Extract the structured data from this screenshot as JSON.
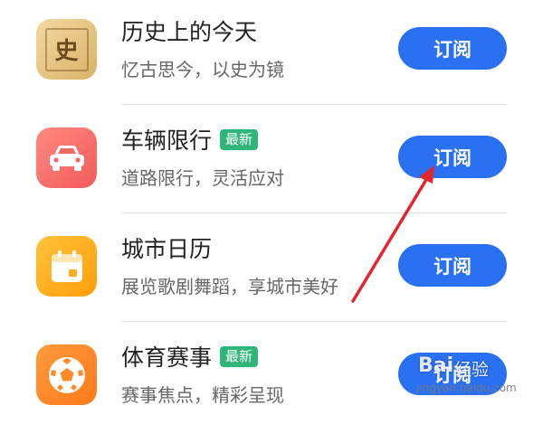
{
  "colors": {
    "button": "#2970f3",
    "badge": "#2fb47a",
    "arrow": "#e3262b"
  },
  "subscriptions": [
    {
      "title": "历史上的今天",
      "subtitle": "忆古思今，以史为镜",
      "badge": "",
      "button": "订阅",
      "icon": "history-scroll-icon",
      "icon_char": "史"
    },
    {
      "title": "车辆限行",
      "subtitle": "道路限行，灵活应对",
      "badge": "最新",
      "button": "订阅",
      "icon": "car-icon",
      "icon_char": ""
    },
    {
      "title": "城市日历",
      "subtitle": "展览歌剧舞蹈，享城市美好",
      "badge": "",
      "button": "订阅",
      "icon": "calendar-icon",
      "icon_char": ""
    },
    {
      "title": "体育赛事",
      "subtitle": "赛事焦点，精彩呈现",
      "badge": "最新",
      "button": "订阅",
      "icon": "soccer-ball-icon",
      "icon_char": ""
    }
  ],
  "watermark": {
    "logo": "Bai",
    "brand": "经验",
    "domain": "jingyan.baidu.com"
  }
}
